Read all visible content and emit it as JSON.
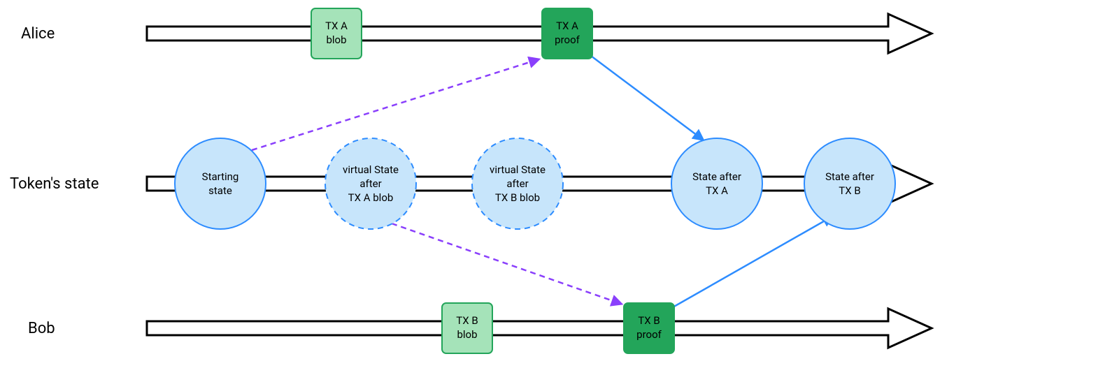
{
  "lanes": {
    "alice": "Alice",
    "token": "Token's state",
    "bob": "Bob"
  },
  "boxes": {
    "txa_blob": {
      "line1": "TX A",
      "line2": "blob"
    },
    "txa_proof": {
      "line1": "TX A",
      "line2": "proof"
    },
    "txb_blob": {
      "line1": "TX B",
      "line2": "blob"
    },
    "txb_proof": {
      "line1": "TX B",
      "line2": "proof"
    }
  },
  "states": {
    "start": {
      "l1": "Starting",
      "l2": "state",
      "l3": ""
    },
    "va": {
      "l1": "virtual State",
      "l2": "after",
      "l3": "TX A blob"
    },
    "vb": {
      "l1": "virtual State",
      "l2": "after",
      "l3": "TX B blob"
    },
    "after_a": {
      "l1": "State after",
      "l2": "TX A",
      "l3": ""
    },
    "after_b": {
      "l1": "State after",
      "l2": "TX B",
      "l3": ""
    }
  },
  "colors": {
    "blob_fill": "#a5e3b9",
    "proof_fill": "#23a55a",
    "state_fill": "#c7e5fb",
    "state_stroke": "#2d8cff",
    "arrow_blue": "#2d8cff",
    "arrow_purple": "#8a3ffc"
  }
}
